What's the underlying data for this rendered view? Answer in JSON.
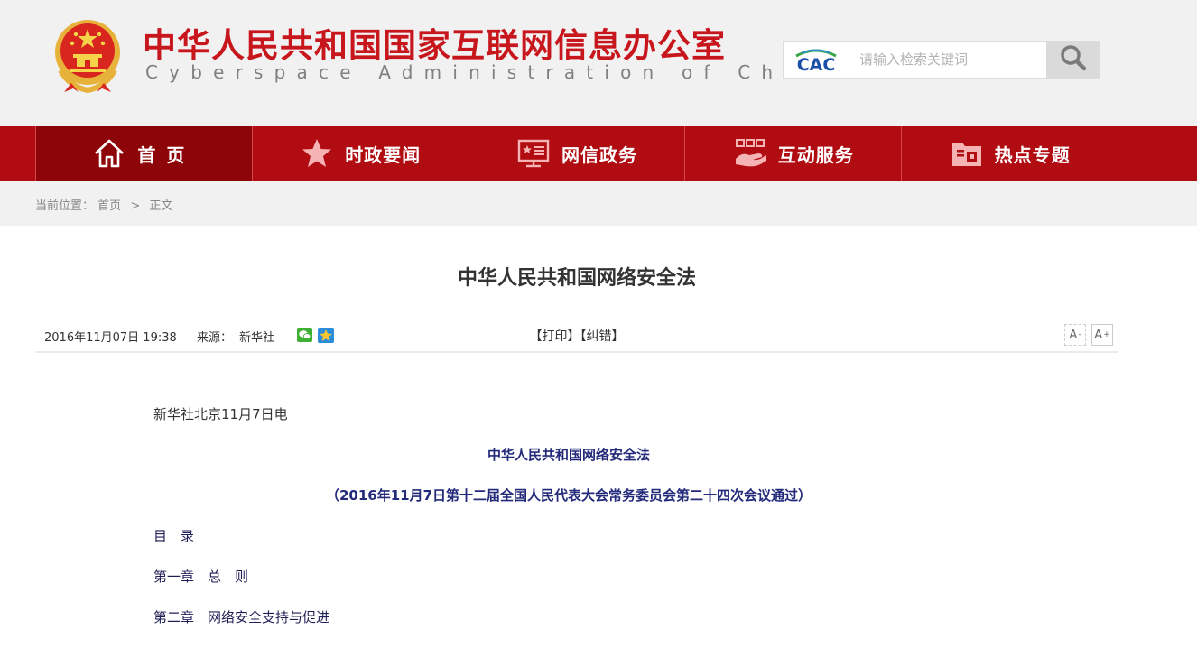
{
  "header": {
    "title": "中华人民共和国国家互联网信息办公室",
    "subtitle": "Cyberspace Administration of China",
    "emblem_icon": "national-emblem-icon",
    "search": {
      "logo_text": "CAC",
      "placeholder": "请输入检索关键词",
      "value": "",
      "button_icon": "search-icon"
    }
  },
  "nav": {
    "items": [
      {
        "label": "首页",
        "icon": "home-icon",
        "active": true
      },
      {
        "label": "时政要闻",
        "icon": "star-icon",
        "active": false
      },
      {
        "label": "网信政务",
        "icon": "monitor-icon",
        "active": false
      },
      {
        "label": "互动服务",
        "icon": "hand-grid-icon",
        "active": false
      },
      {
        "label": "热点专题",
        "icon": "folder-icon",
        "active": false
      }
    ]
  },
  "breadcrumb": {
    "prefix": "当前位置：",
    "home": "首页",
    "separator": ">",
    "current": "正文"
  },
  "article": {
    "title": "中华人民共和国网络安全法",
    "date": "2016年11月07日 19:38",
    "source_label": "来源：",
    "source_value": "新华社",
    "share_icons": [
      "wechat-icon",
      "qzone-icon"
    ],
    "print_label": "【打印】",
    "correct_label": "【纠错】",
    "font_small": "A",
    "font_large": "A",
    "paragraphs": [
      {
        "text": "新华社北京11月7日电",
        "style": "lead"
      },
      {
        "text": "中华人民共和国网络安全法",
        "style": "center"
      },
      {
        "text": "（2016年11月7日第十二届全国人民代表大会常务委员会第二十四次会议通过）",
        "style": "center"
      },
      {
        "text": "目　录",
        "style": "normal"
      },
      {
        "text": "第一章　总　则",
        "style": "normal"
      },
      {
        "text": "第二章　网络安全支持与促进",
        "style": "normal"
      }
    ]
  },
  "colors": {
    "brand_red": "#c8161d",
    "nav_red": "#b00c12",
    "nav_active": "#8e0509",
    "body_navy": "#1f1f57"
  }
}
